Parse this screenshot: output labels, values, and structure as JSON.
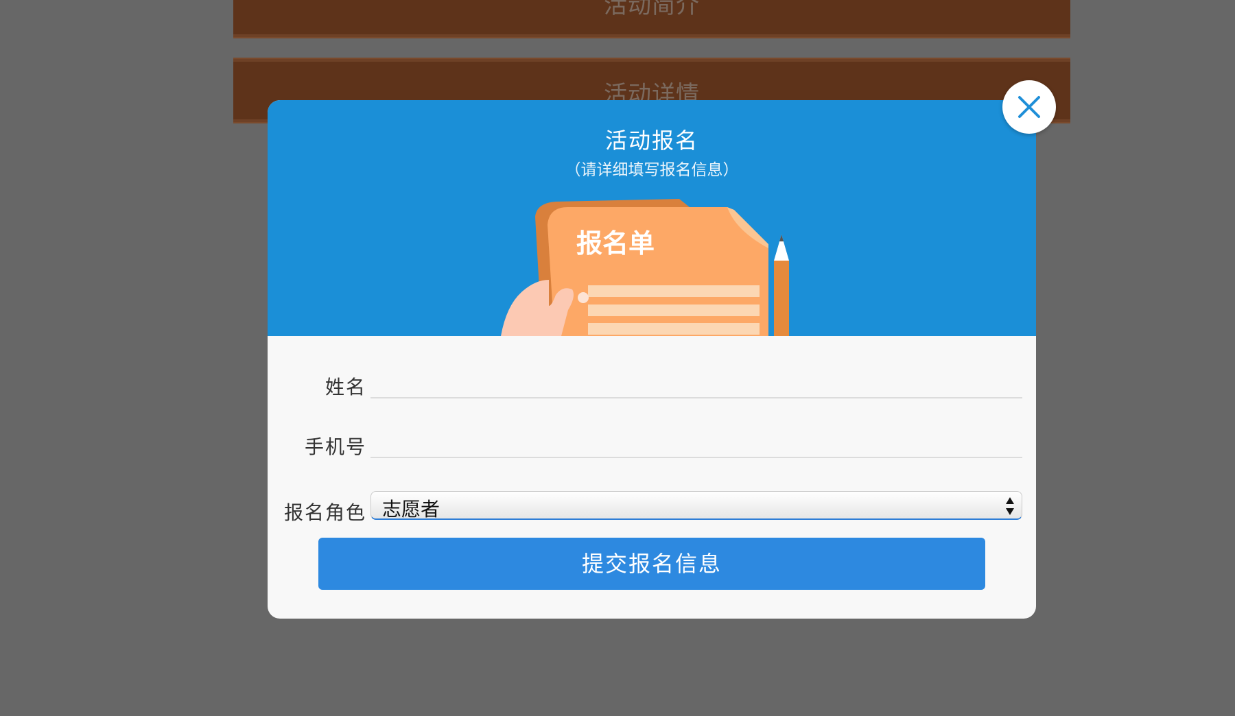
{
  "background": {
    "sections": [
      {
        "title": "活动简介"
      },
      {
        "title": "活动详情"
      }
    ]
  },
  "modal": {
    "title": "活动报名",
    "subtitle": "（请详细填写报名信息）",
    "illustration": {
      "icon": "signup-form-illustration",
      "text": "报名单"
    },
    "form": {
      "name_label": "姓名",
      "name_value": "",
      "phone_label": "手机号",
      "phone_value": "",
      "role_label": "报名角色",
      "role_value": "志愿者"
    },
    "submit_label": "提交报名信息",
    "close_icon": "close-icon"
  },
  "colors": {
    "header_blue": "#1b8fd7",
    "button_blue": "#2d89e0",
    "section_brown": "#5e331a",
    "overlay_gray": "#676767"
  }
}
